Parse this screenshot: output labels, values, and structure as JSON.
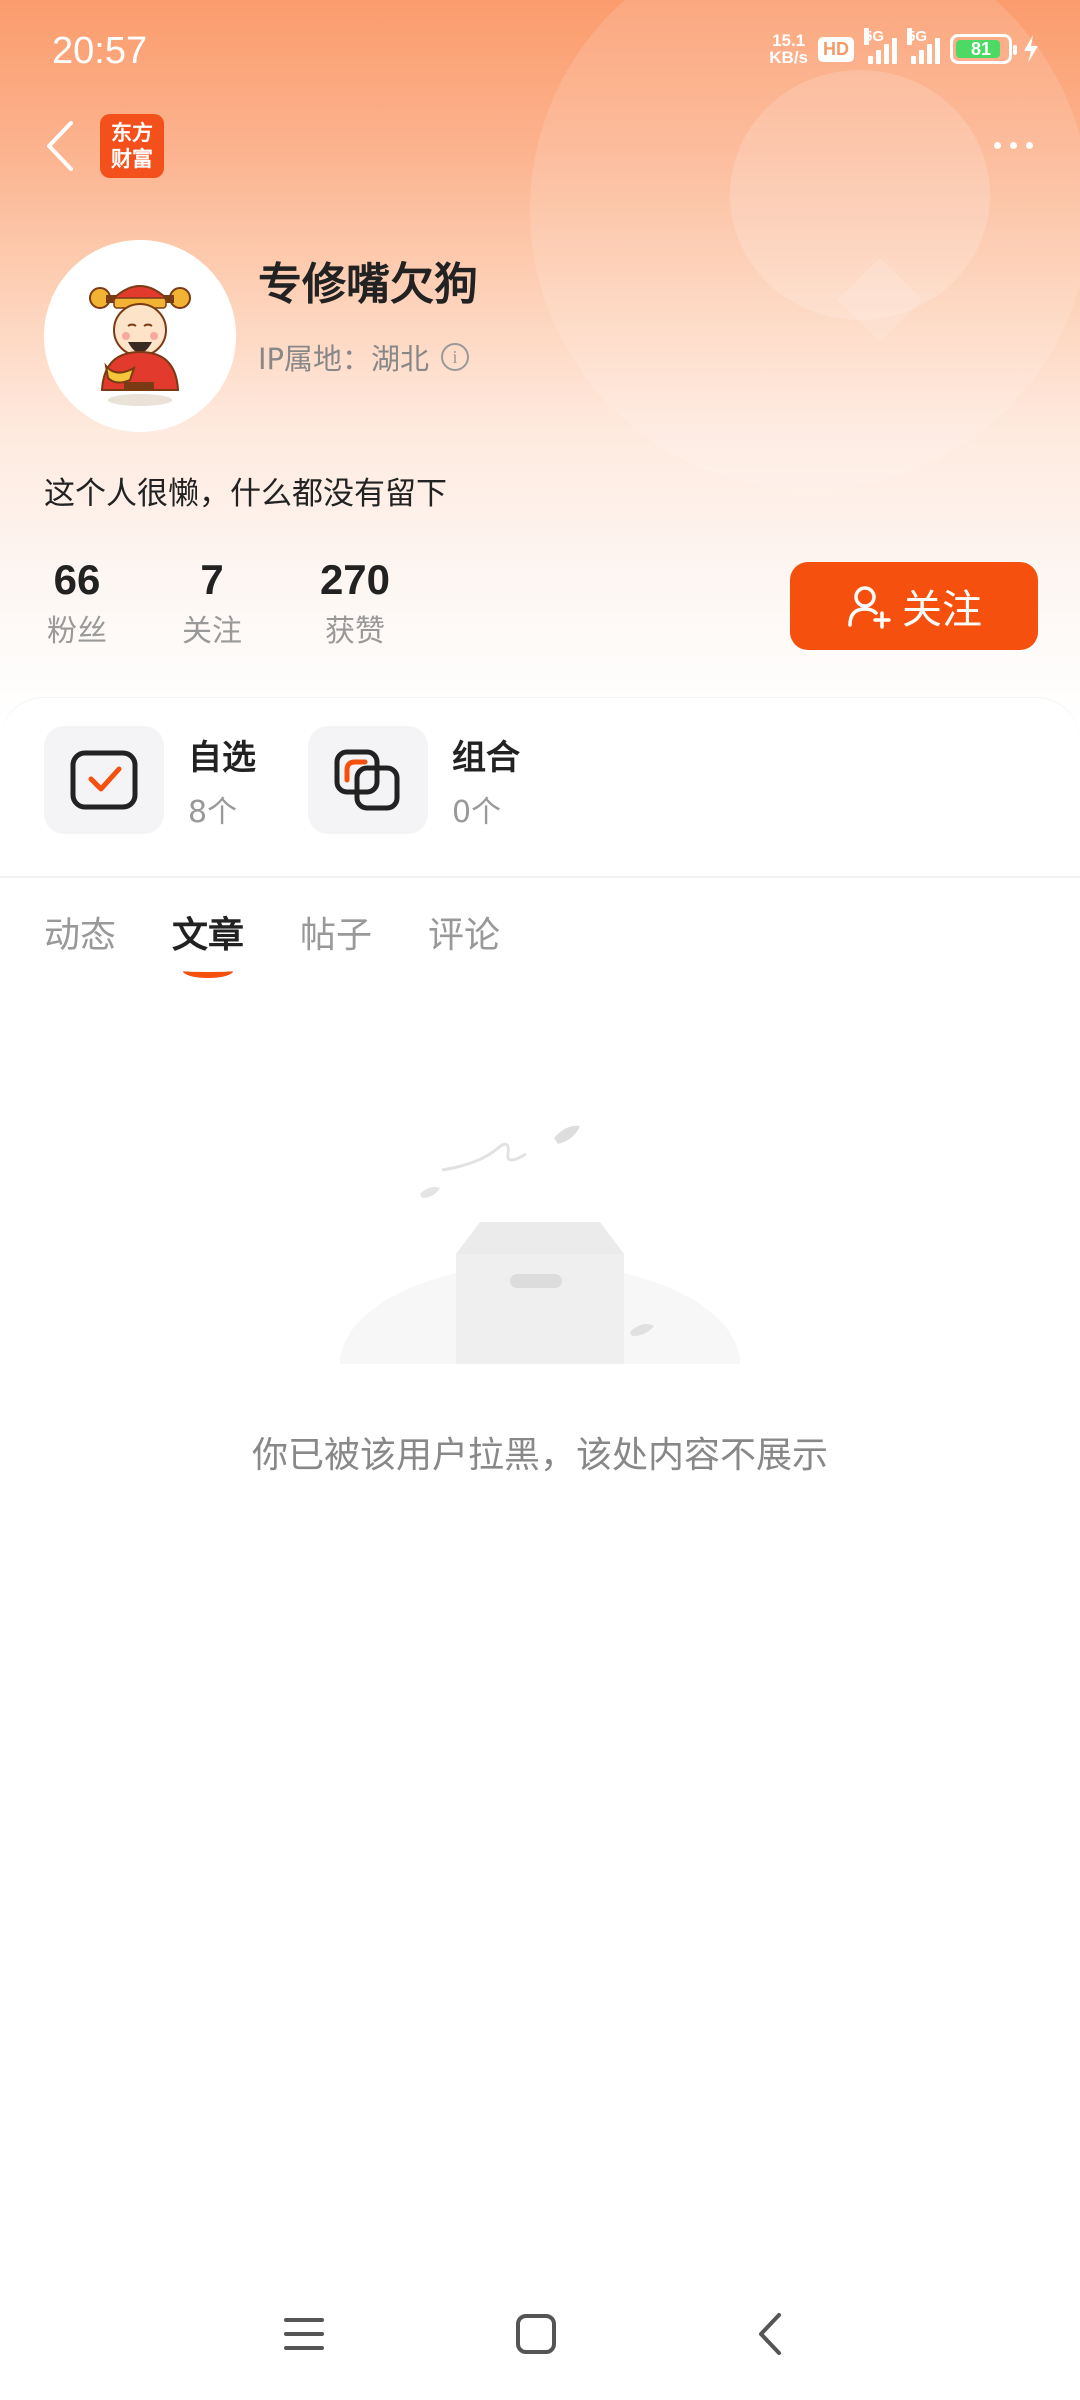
{
  "status_bar": {
    "time": "20:57",
    "net_speed_value": "15.1",
    "net_speed_unit": "KB/s",
    "hd_label": "HD",
    "signal1_label": "5G",
    "signal2_label": "5G",
    "battery_level": "81"
  },
  "nav": {
    "logo_line1": "东方",
    "logo_line2": "财富"
  },
  "profile": {
    "username": "专修嘴欠狗",
    "ip_location": "IP属地：湖北",
    "bio": "这个人很懒，什么都没有留下"
  },
  "stats": [
    {
      "value": "66",
      "label": "粉丝"
    },
    {
      "value": "7",
      "label": "关注"
    },
    {
      "value": "270",
      "label": "获赞"
    }
  ],
  "follow_button_label": "关注",
  "shortcuts": [
    {
      "title": "自选",
      "count": "8个"
    },
    {
      "title": "组合",
      "count": "0个"
    }
  ],
  "tabs": [
    {
      "label": "动态",
      "active": false
    },
    {
      "label": "文章",
      "active": true
    },
    {
      "label": "帖子",
      "active": false
    },
    {
      "label": "评论",
      "active": false
    }
  ],
  "empty_state_text": "你已被该用户拉黑，该处内容不展示",
  "colors": {
    "accent": "#f5500d",
    "header_gradient_top": "#fb9c6d"
  },
  "icons": [
    "back-arrow-icon",
    "more-icon",
    "info-icon",
    "follow-user-icon",
    "watchlist-icon",
    "portfolio-icon",
    "menu-icon",
    "home-icon",
    "back-icon"
  ]
}
